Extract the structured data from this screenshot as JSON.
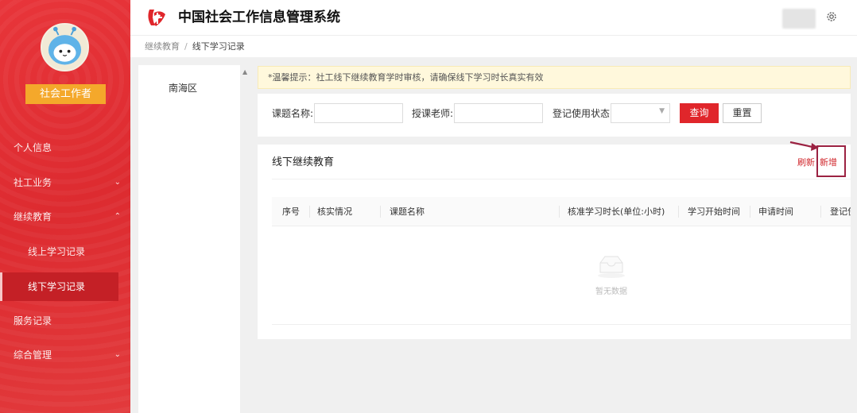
{
  "app": {
    "title": "中国社会工作信息管理系统"
  },
  "user": {
    "role": "社会工作者"
  },
  "sidebar": {
    "items": [
      {
        "label": "个人信息"
      },
      {
        "label": "社工业务"
      },
      {
        "label": "继续教育"
      },
      {
        "label": "线上学习记录"
      },
      {
        "label": "线下学习记录"
      },
      {
        "label": "服务记录"
      },
      {
        "label": "综合管理"
      }
    ]
  },
  "breadcrumb": {
    "parent": "继续教育",
    "separator": "/",
    "current": "线下学习记录"
  },
  "tree": {
    "items": [
      {
        "label": "南海区"
      }
    ]
  },
  "notice": {
    "text": "*温馨提示：社工线下继续教育学时审核，请确保线下学习时长真实有效"
  },
  "search": {
    "course_name_label": "课题名称:",
    "teacher_label": "授课老师:",
    "status_label": "登记使用状态:",
    "query_button": "查询",
    "reset_button": "重置"
  },
  "table": {
    "title": "线下继续教育",
    "refresh_label": "刷新",
    "add_label": "新增",
    "columns": [
      {
        "label": "序号"
      },
      {
        "label": "核实情况"
      },
      {
        "label": "课题名称"
      },
      {
        "label": "核准学习时长(单位:小时)"
      },
      {
        "label": "学习开始时间"
      },
      {
        "label": "申请时间"
      },
      {
        "label": "登记使"
      }
    ],
    "rows": [],
    "empty_text": "暂无数据"
  },
  "colors": {
    "primary": "#e0262b",
    "sidebar": "#e23236",
    "badge": "#f4a82b",
    "highlight": "#9b2242"
  }
}
